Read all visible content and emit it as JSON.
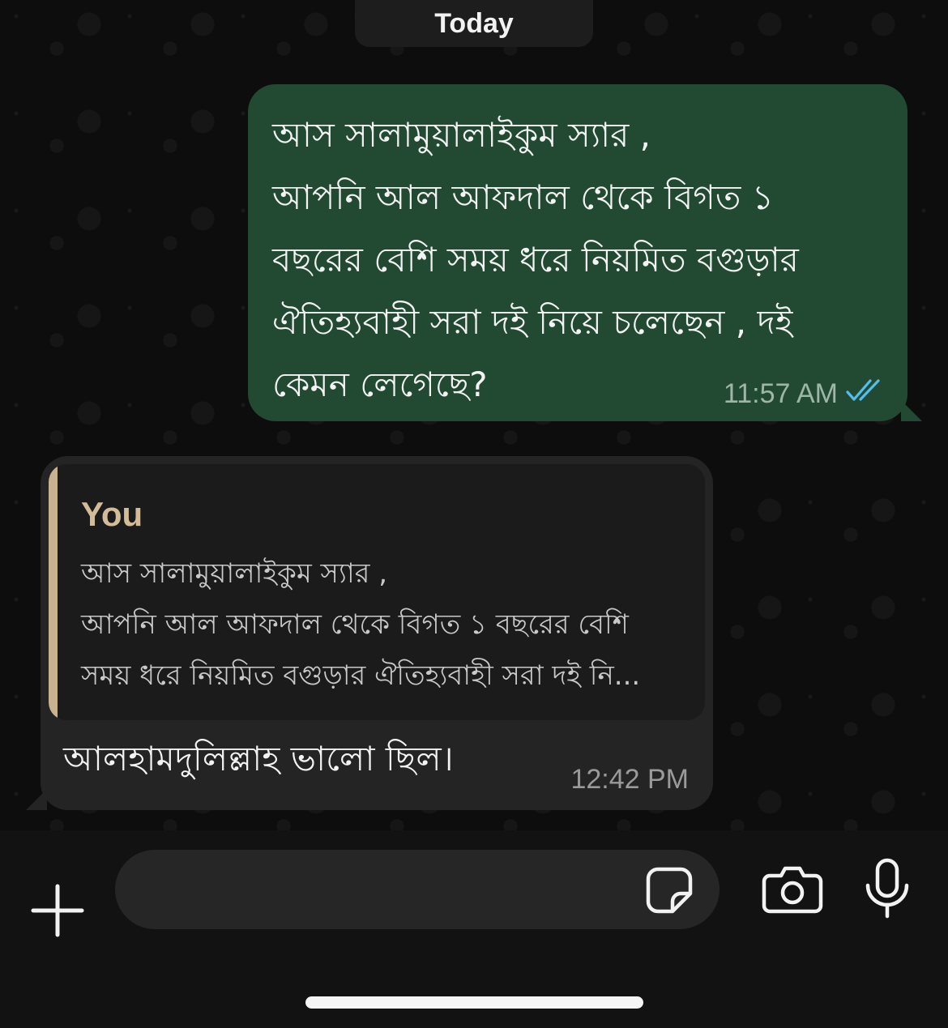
{
  "chat": {
    "date_label": "Today",
    "messages": [
      {
        "direction": "outgoing",
        "text": "আস সালামুয়ালাইকুম স্যার ,\nআপনি আল আফদাল থেকে বিগত ১\nবছরের বেশি সময় ধরে নিয়মিত বগুড়ার\nঐতিহ্যবাহী সরা দই নিয়ে চলেছেন , দই\nকেমন লেগেছে?",
        "time": "11:57 AM",
        "status_icon": "double-check-read-icon",
        "status_color": "#53bdeb"
      },
      {
        "direction": "incoming",
        "quoted": {
          "author": "You",
          "text": "আস সালামুয়ালাইকুম স্যার ,\nআপনি আল আফদাল থেকে বিগত ১ বছরের বেশি\nসময় ধরে নিয়মিত বগুড়ার ঐতিহ্যবাহী সরা দই নি..."
        },
        "text": "আলহামদুলিল্লাহ ভালো ছিল।",
        "time": "12:42 PM"
      }
    ]
  },
  "composer": {
    "placeholder": "",
    "icons": [
      "plus-icon",
      "sticker-icon",
      "camera-icon",
      "microphone-icon"
    ]
  },
  "colors": {
    "outgoing_bubble": "#224a33",
    "incoming_bubble": "#242424",
    "quote_bar": "#c8b28f",
    "quote_author": "#d3bd98"
  }
}
